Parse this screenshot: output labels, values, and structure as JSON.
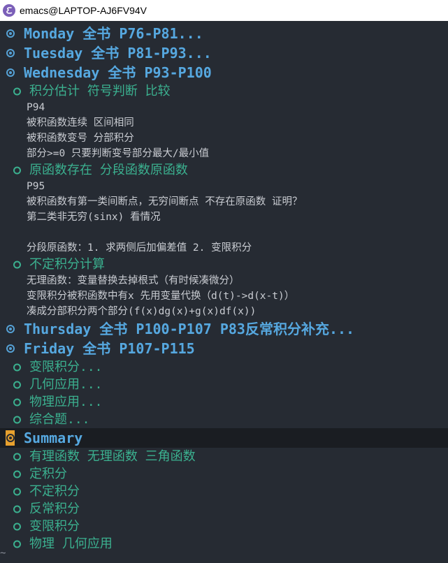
{
  "window": {
    "title": "emacs@LAPTOP-AJ6FV94V"
  },
  "buffer": {
    "lines": [
      {
        "kind": "h1",
        "text": "Monday 全书 P76-P81..."
      },
      {
        "kind": "h1",
        "text": "Tuesday 全书 P81-P93..."
      },
      {
        "kind": "h1",
        "text": "Wednesday 全书 P93-P100"
      },
      {
        "kind": "h2",
        "text": "积分估计 符号判断 比较"
      },
      {
        "kind": "body",
        "text": "P94"
      },
      {
        "kind": "body",
        "text": "被积函数连续 区间相同"
      },
      {
        "kind": "body",
        "text": "被积函数变号 分部积分"
      },
      {
        "kind": "body",
        "text": "部分>=0 只要判断变号部分最大/最小值"
      },
      {
        "kind": "h2",
        "text": "原函数存在 分段函数原函数"
      },
      {
        "kind": "body",
        "text": "P95"
      },
      {
        "kind": "body",
        "text": "被积函数有第一类间断点，无穷间断点 不存在原函数 证明？"
      },
      {
        "kind": "body",
        "text": "第二类非无穷(sinx) 看情况"
      },
      {
        "kind": "body",
        "text": ""
      },
      {
        "kind": "body",
        "text": "分段原函数：1. 求两侧后加偏差值 2. 变限积分"
      },
      {
        "kind": "h2",
        "text": "不定积分计算"
      },
      {
        "kind": "body",
        "text": "无理函数：变量替换去掉根式（有时候凑微分）"
      },
      {
        "kind": "body",
        "text": "变限积分被积函数中有x 先用变量代换（d(t)->d(x-t)）"
      },
      {
        "kind": "body",
        "text": "凑成分部积分两个部分(f(x)dg(x)+g(x)df(x))"
      },
      {
        "kind": "h1",
        "text": "Thursday 全书 P100-P107 P83反常积分补充..."
      },
      {
        "kind": "h1",
        "text": "Friday 全书 P107-P115"
      },
      {
        "kind": "h2",
        "text": "变限积分..."
      },
      {
        "kind": "h2",
        "text": "几何应用..."
      },
      {
        "kind": "h2",
        "text": "物理应用..."
      },
      {
        "kind": "h2",
        "text": "综合题..."
      },
      {
        "kind": "h1",
        "text": "Summary",
        "cursor": true
      },
      {
        "kind": "h2",
        "text": "有理函数 无理函数 三角函数"
      },
      {
        "kind": "h2",
        "text": "定积分"
      },
      {
        "kind": "h2",
        "text": "不定积分"
      },
      {
        "kind": "h2",
        "text": "反常积分"
      },
      {
        "kind": "h2",
        "text": "变限积分"
      },
      {
        "kind": "h2",
        "text": "物理 几何应用"
      }
    ],
    "end_marker": "~"
  },
  "colors": {
    "background": "#262b33",
    "heading1": "#56a8e0",
    "heading2": "#3bb08f",
    "body_text": "#c9ccd2",
    "cursor": "#e8a12e",
    "current_line": "#1a1d22"
  }
}
